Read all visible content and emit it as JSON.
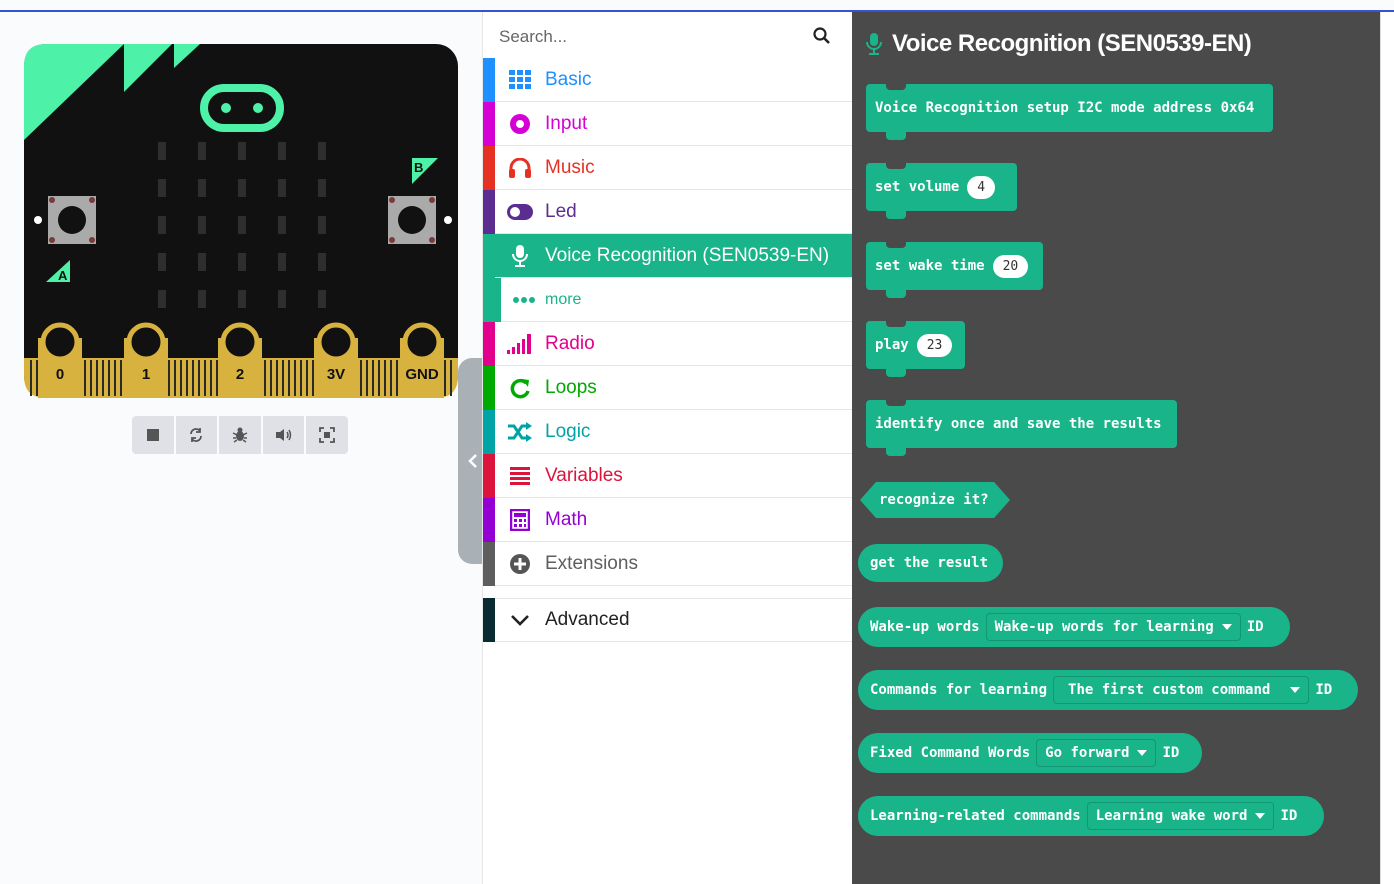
{
  "simulator": {
    "pins": [
      "0",
      "1",
      "2",
      "3V",
      "GND"
    ],
    "buttons": [
      "A",
      "B"
    ],
    "toolbar": [
      "stop-icon",
      "restart-icon",
      "debug-icon",
      "sound-icon",
      "fullscreen-icon"
    ]
  },
  "toolbox": {
    "search_placeholder": "Search...",
    "categories": [
      {
        "label": "Basic",
        "color": "#1e90ff"
      },
      {
        "label": "Input",
        "color": "#d400d4"
      },
      {
        "label": "Music",
        "color": "#e63022"
      },
      {
        "label": "Led",
        "color": "#5c2d91"
      },
      {
        "label": "Voice Recognition (SEN0539-EN)",
        "color": "#1ab48a"
      },
      {
        "label": "Radio",
        "color": "#e3008c"
      },
      {
        "label": "Loops",
        "color": "#00aa00"
      },
      {
        "label": "Logic",
        "color": "#00a4a6"
      },
      {
        "label": "Variables",
        "color": "#dc143c"
      },
      {
        "label": "Math",
        "color": "#9400d3"
      },
      {
        "label": "Extensions",
        "color": "#5e5e5e"
      }
    ],
    "more_label": "more",
    "advanced_label": "Advanced"
  },
  "flyout": {
    "title": "Voice Recognition (SEN0539-EN)",
    "blocks": {
      "setup": "Voice Recognition setup I2C mode address 0x64",
      "set_volume": "set volume",
      "volume_value": "4",
      "set_wake_time": "set wake time",
      "wake_time_value": "20",
      "play": "play",
      "play_value": "23",
      "identify": "identify once and save the results",
      "recognize": "recognize it?",
      "get_result": "get the result",
      "wake_words": "Wake-up words",
      "wake_words_dd": "Wake-up words for learning",
      "commands_learning": "Commands for learning",
      "commands_learning_dd": "The first custom command",
      "fixed_words": "Fixed Command Words",
      "fixed_words_dd": "Go forward",
      "learning_related": "Learning-related commands",
      "learning_related_dd": "Learning wake word",
      "id_label": "ID"
    }
  },
  "colors": {
    "accent": "#1ab48a",
    "flyout_bg": "#4b4a4a",
    "board_green": "#4df2a8",
    "pin_gold": "#d8b23f"
  }
}
